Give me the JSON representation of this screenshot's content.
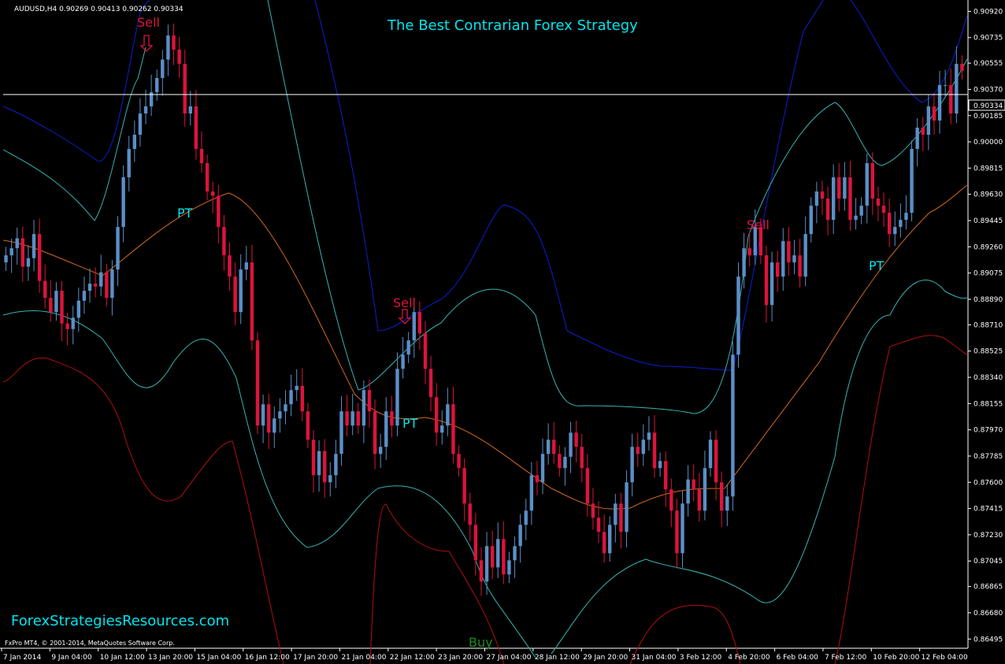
{
  "header": {
    "symbol_info": "AUDUSD,H4  0.90269 0.90413 0.90262 0.90334"
  },
  "title": "The Best Contrarian Forex Strategy",
  "watermark": "ForexStrategiesResources.com",
  "copyright": "FxPro MT4, © 2001-2014, MetaQuotes Software Corp.",
  "current_price_label": "0.90334",
  "colors": {
    "background": "#000000",
    "bull": "#5b8fc7",
    "bear": "#dc143c",
    "title": "#00e5ee",
    "sell": "#dc143c",
    "pt": "#00e5ee",
    "buy": "#1f8b1f",
    "band_outer": "#0a1fd0",
    "band_inner": "#38b2b2",
    "middle": "#d2691e",
    "band_lower_outer": "#b01010",
    "axis_text": "#ffffff",
    "price_line": "#ffffff"
  },
  "chart_data": {
    "type": "candlestick",
    "symbol": "AUDUSD",
    "timeframe": "H4",
    "y_ticks": [
      "0.90920",
      "0.90735",
      "0.90555",
      "0.90370",
      "0.90185",
      "0.90000",
      "0.89815",
      "0.89630",
      "0.89445",
      "0.89260",
      "0.89075",
      "0.88890",
      "0.88710",
      "0.88525",
      "0.88340",
      "0.88155",
      "0.87970",
      "0.87785",
      "0.87600",
      "0.87415",
      "0.87230",
      "0.87045",
      "0.86865",
      "0.86680",
      "0.86495"
    ],
    "ylim": [
      0.8643,
      0.91
    ],
    "x_ticks": [
      "7 Jan 2014",
      "9 Jan 04:00",
      "10 Jan 12:00",
      "13 Jan 20:00",
      "15 Jan 04:00",
      "16 Jan 12:00",
      "17 Jan 20:00",
      "21 Jan 04:00",
      "22 Jan 12:00",
      "23 Jan 20:00",
      "27 Jan 04:00",
      "28 Jan 12:00",
      "29 Jan 20:00",
      "31 Jan 04:00",
      "3 Feb 12:00",
      "4 Feb 20:00",
      "6 Feb 04:00",
      "7 Feb 12:00",
      "10 Feb 20:00",
      "12 Feb 04:00"
    ],
    "current_price": 0.90334,
    "close": [
      0.892,
      0.8925,
      0.8932,
      0.8912,
      0.8918,
      0.8935,
      0.8902,
      0.889,
      0.888,
      0.8895,
      0.8872,
      0.8868,
      0.8876,
      0.8888,
      0.8895,
      0.89,
      0.8898,
      0.8908,
      0.889,
      0.891,
      0.894,
      0.8975,
      0.8995,
      0.9005,
      0.902,
      0.9025,
      0.9035,
      0.9045,
      0.9058,
      0.9075,
      0.9065,
      0.9055,
      0.902,
      0.9025,
      0.8995,
      0.8985,
      0.8965,
      0.8962,
      0.894,
      0.892,
      0.8905,
      0.888,
      0.891,
      0.8915,
      0.886,
      0.88,
      0.8815,
      0.8795,
      0.8805,
      0.881,
      0.8815,
      0.8825,
      0.8828,
      0.881,
      0.879,
      0.8765,
      0.8782,
      0.876,
      0.8765,
      0.878,
      0.881,
      0.88,
      0.881,
      0.88,
      0.8825,
      0.881,
      0.878,
      0.8785,
      0.881,
      0.88,
      0.884,
      0.885,
      0.886,
      0.888,
      0.8865,
      0.884,
      0.882,
      0.8795,
      0.88,
      0.8815,
      0.878,
      0.877,
      0.8745,
      0.873,
      0.8705,
      0.869,
      0.8715,
      0.87,
      0.872,
      0.8695,
      0.8705,
      0.8715,
      0.873,
      0.874,
      0.8765,
      0.876,
      0.878,
      0.879,
      0.878,
      0.877,
      0.8778,
      0.8795,
      0.8785,
      0.877,
      0.8745,
      0.8735,
      0.8725,
      0.871,
      0.873,
      0.8745,
      0.8725,
      0.876,
      0.8785,
      0.878,
      0.879,
      0.8795,
      0.877,
      0.8775,
      0.8755,
      0.874,
      0.871,
      0.8745,
      0.8762,
      0.8755,
      0.874,
      0.877,
      0.879,
      0.876,
      0.874,
      0.875,
      0.885,
      0.8905,
      0.8925,
      0.892,
      0.894,
      0.892,
      0.8885,
      0.8915,
      0.8905,
      0.893,
      0.8915,
      0.892,
      0.8905,
      0.8935,
      0.8955,
      0.8965,
      0.896,
      0.8945,
      0.8975,
      0.896,
      0.8975,
      0.8945,
      0.8948,
      0.8955,
      0.8985,
      0.896,
      0.8955,
      0.895,
      0.8935,
      0.894,
      0.8945,
      0.895,
      0.8995,
      0.901,
      0.9005,
      0.9025,
      0.9015,
      0.904,
      0.904,
      0.902,
      0.9055,
      0.905
    ]
  }
}
